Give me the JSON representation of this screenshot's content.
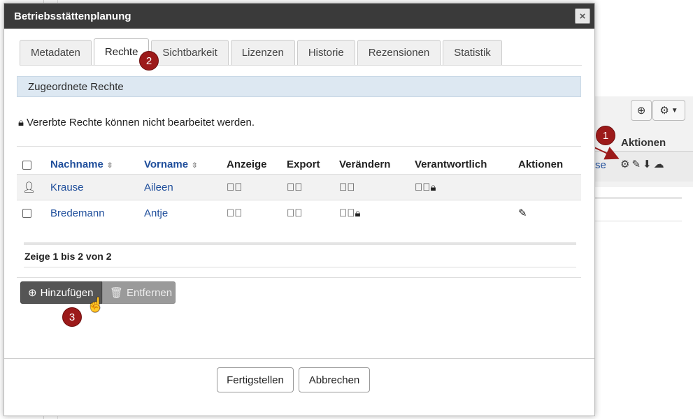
{
  "modal": {
    "title": "Betriebsstättenplanung",
    "close_label": "×",
    "tabs": [
      {
        "label": "Metadaten"
      },
      {
        "label": "Rechte"
      },
      {
        "label": "Sichtbarkeit"
      },
      {
        "label": "Lizenzen"
      },
      {
        "label": "Historie"
      },
      {
        "label": "Rezensionen"
      },
      {
        "label": "Statistik"
      }
    ],
    "active_tab": "Rechte",
    "section_title": "Zugeordnete Rechte",
    "notice": "Vererbte Rechte können nicht bearbeitet werden.",
    "table": {
      "headers": {
        "nachname": "Nachname",
        "vorname": "Vorname",
        "anzeige": "Anzeige",
        "export": "Export",
        "veraendern": "Verändern",
        "verantwortlich": "Verantwortlich",
        "aktionen": "Aktionen"
      },
      "rows": [
        {
          "nachname": "Krause",
          "vorname": "Aileen"
        },
        {
          "nachname": "Bredemann",
          "vorname": "Antje"
        }
      ]
    },
    "pager": "Zeige 1 bis 2 von 2",
    "buttons": {
      "add": "Hinzufügen",
      "remove": "Entfernen",
      "finish": "Fertigstellen",
      "cancel": "Abbrechen"
    }
  },
  "background": {
    "actions_header": "Aktionen",
    "row_link": "se"
  },
  "badges": [
    "1",
    "2",
    "3"
  ],
  "colors": {
    "header_bg": "#3a3a3a",
    "link": "#1f4e9b",
    "section_bg": "#dde8f2",
    "badge": "#9c1a1a",
    "arrow": "#9c1a1a"
  }
}
